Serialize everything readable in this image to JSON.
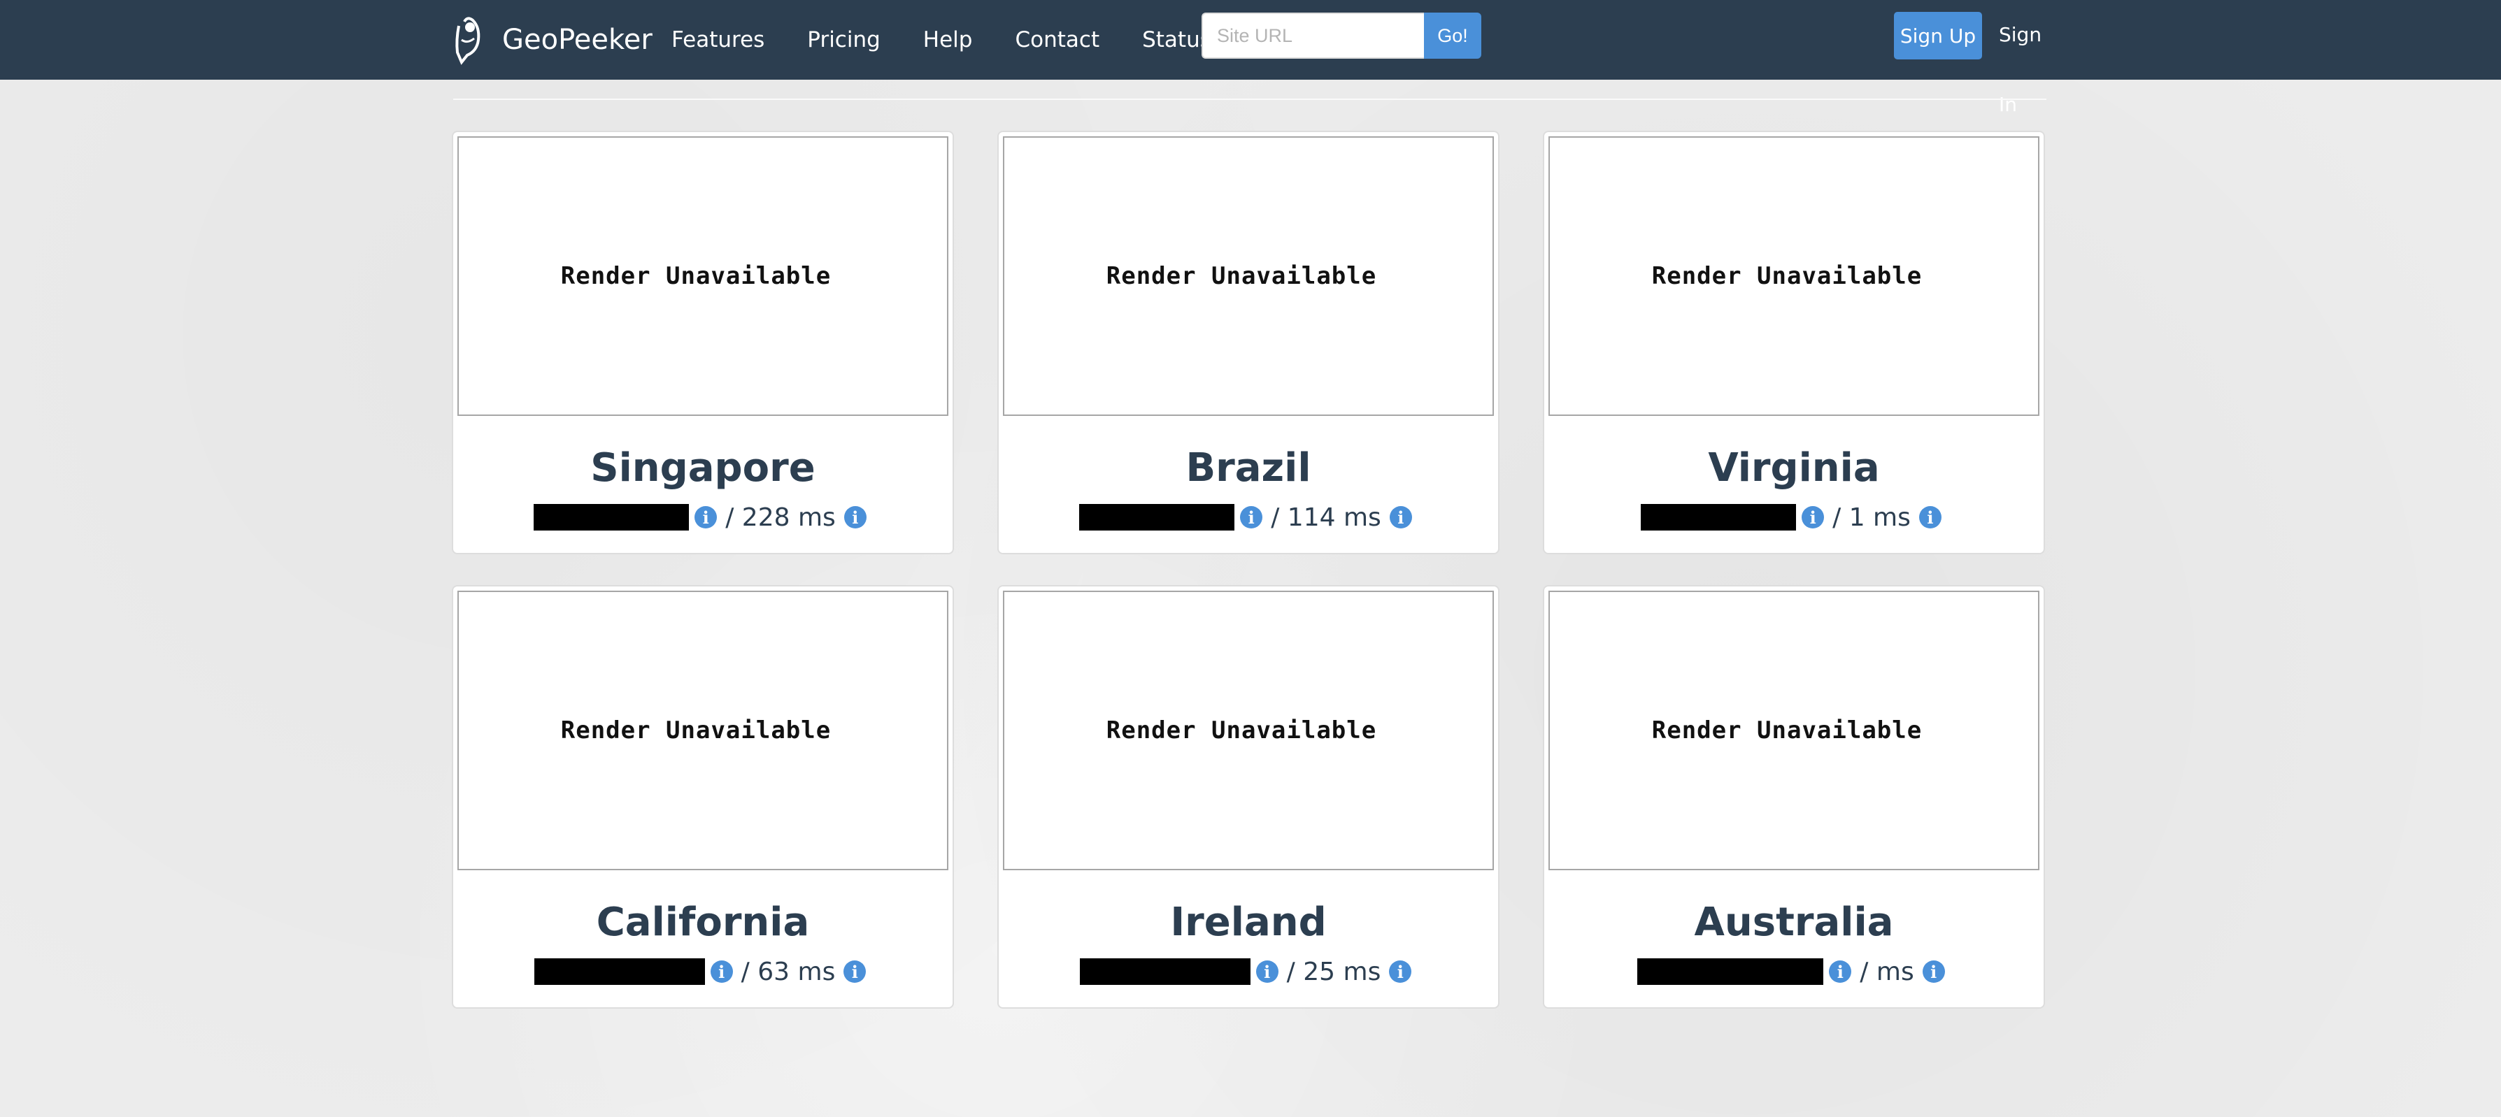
{
  "nav": {
    "brand": "GeoPeeker",
    "links": [
      "Features",
      "Pricing",
      "Help",
      "Contact",
      "Status"
    ],
    "search_placeholder": "Site URL",
    "search_button": "Go!",
    "signup": "Sign Up",
    "signin": "Sign In"
  },
  "render_unavailable": "Render Unavailable",
  "locations": [
    {
      "name": "Singapore",
      "time": "/ 228 ms"
    },
    {
      "name": "Brazil",
      "time": "/ 114 ms"
    },
    {
      "name": "Virginia",
      "time": "/ 1 ms"
    },
    {
      "name": "California",
      "time": "/ 63 ms"
    },
    {
      "name": "Ireland",
      "time": "/ 25 ms"
    },
    {
      "name": "Australia",
      "time": "/ ms"
    }
  ],
  "colors": {
    "navbar": "#2c3e50",
    "accent": "#4a90d9",
    "heading": "#2c3e50"
  },
  "icons": {
    "info": "info-icon",
    "logo": "geopeeker-logo"
  }
}
